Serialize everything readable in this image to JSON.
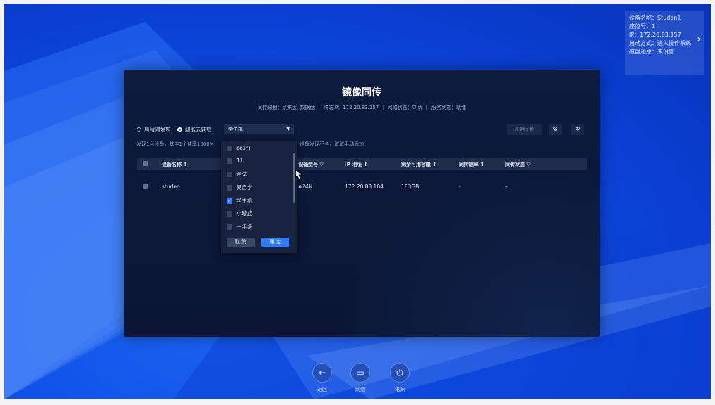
{
  "info": {
    "device_name": "设备名称：Studen1",
    "seat": "座位号：1",
    "ip": "IP：172.20.83.157",
    "boot": "启动方式：进入操作系统",
    "disk_restore": "磁盘还原：未设置"
  },
  "dialog": {
    "title": "镜像同传",
    "subtitle": {
      "disk": "同传磁盘：系统盘, 数据盘",
      "terminal_ip": "终端IP：172.20.83.157",
      "net": "网络状态：ᗜ 优",
      "service": "服务状态：就绪"
    },
    "radio_lan": "局域网发现",
    "radio_cloud": "超能云获取",
    "select_value": "学生机",
    "hint": "发现1台设备，其中1个速率1000M",
    "hint2": "设备发现不全，试试手动添加",
    "start_button": "开始同传",
    "columns": [
      "设备名称 ↕",
      "设备型号 ▽",
      "IP 地址 ↕",
      "剩余可用容量 ↕",
      "同传速率 ↕",
      "同传状态 ▽"
    ],
    "rows": [
      {
        "name": "studen",
        "model": "A24N",
        "ip": "172.20.83.104",
        "capacity": "183GB",
        "rate": "-",
        "status": "-"
      }
    ]
  },
  "dropdown": {
    "options": [
      {
        "label": "ceshi",
        "checked": false
      },
      {
        "label": "11",
        "checked": false
      },
      {
        "label": "测试",
        "checked": false
      },
      {
        "label": "易启学",
        "checked": false
      },
      {
        "label": "学生机",
        "checked": true
      },
      {
        "label": "小璇族",
        "checked": false
      },
      {
        "label": "一年级",
        "checked": false
      }
    ],
    "cancel": "取 消",
    "confirm": "确 定"
  },
  "bottom": {
    "back": "返回",
    "network": "网络",
    "power": "电源"
  },
  "colors": {
    "accent": "#2f7bff",
    "dialog_bg": "#0d1b3d",
    "desktop": "#0f4fe6"
  }
}
